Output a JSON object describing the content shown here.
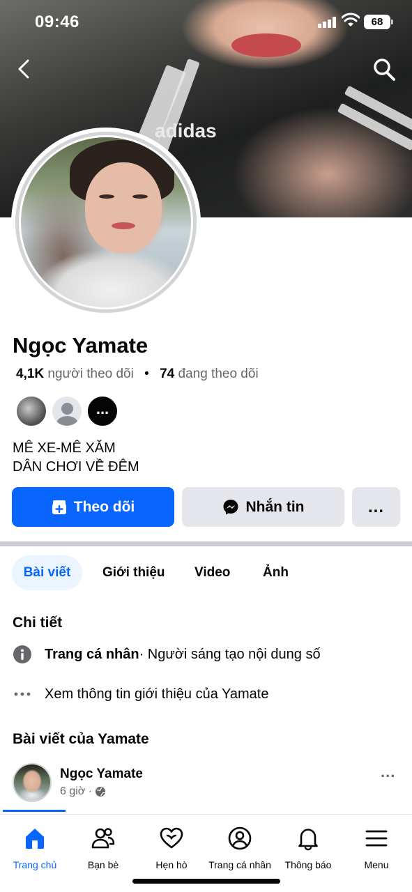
{
  "status_bar": {
    "time": "09:46",
    "battery": "68"
  },
  "cover": {
    "logo_text": "adidas"
  },
  "profile": {
    "name": "Ngọc Yamate",
    "followers_count": "4,1K",
    "followers_label": "người theo dõi",
    "following_count": "74",
    "following_label": "đang theo dõi",
    "mutual_more": "...",
    "bio_line1": "MÊ XE-MÊ XĂM",
    "bio_line2": "DÂN CHƠI VỀ ĐÊM"
  },
  "actions": {
    "follow_label": "Theo dõi",
    "message_label": "Nhắn tin",
    "more_label": "..."
  },
  "tabs": [
    {
      "label": "Bài viết",
      "active": true
    },
    {
      "label": "Giới thiệu",
      "active": false
    },
    {
      "label": "Video",
      "active": false
    },
    {
      "label": "Ảnh",
      "active": false
    }
  ],
  "details": {
    "title": "Chi tiết",
    "profile_type_strong": "Trang cá nhân",
    "profile_type_rest": " · Người sáng tạo nội dung số",
    "see_about": "Xem thông tin giới thiệu của Yamate"
  },
  "posts": {
    "title": "Bài viết của Yamate",
    "first": {
      "author": "Ngọc Yamate",
      "time": "6 giờ ·",
      "more": "..."
    }
  },
  "bottom_nav": [
    {
      "label": "Trang chủ",
      "icon": "home-icon",
      "active": true
    },
    {
      "label": "Bạn bè",
      "icon": "friends-icon",
      "active": false
    },
    {
      "label": "Hẹn hò",
      "icon": "dating-heart-icon",
      "active": false
    },
    {
      "label": "Trang cá nhân",
      "icon": "profile-icon",
      "active": false
    },
    {
      "label": "Thông báo",
      "icon": "bell-icon",
      "active": false
    },
    {
      "label": "Menu",
      "icon": "menu-icon",
      "active": false
    }
  ],
  "colors": {
    "primary": "#0866ff",
    "secondary_button": "#e4e6eb",
    "muted_text": "#65676b",
    "active_tab_bg": "#ebf5ff"
  }
}
